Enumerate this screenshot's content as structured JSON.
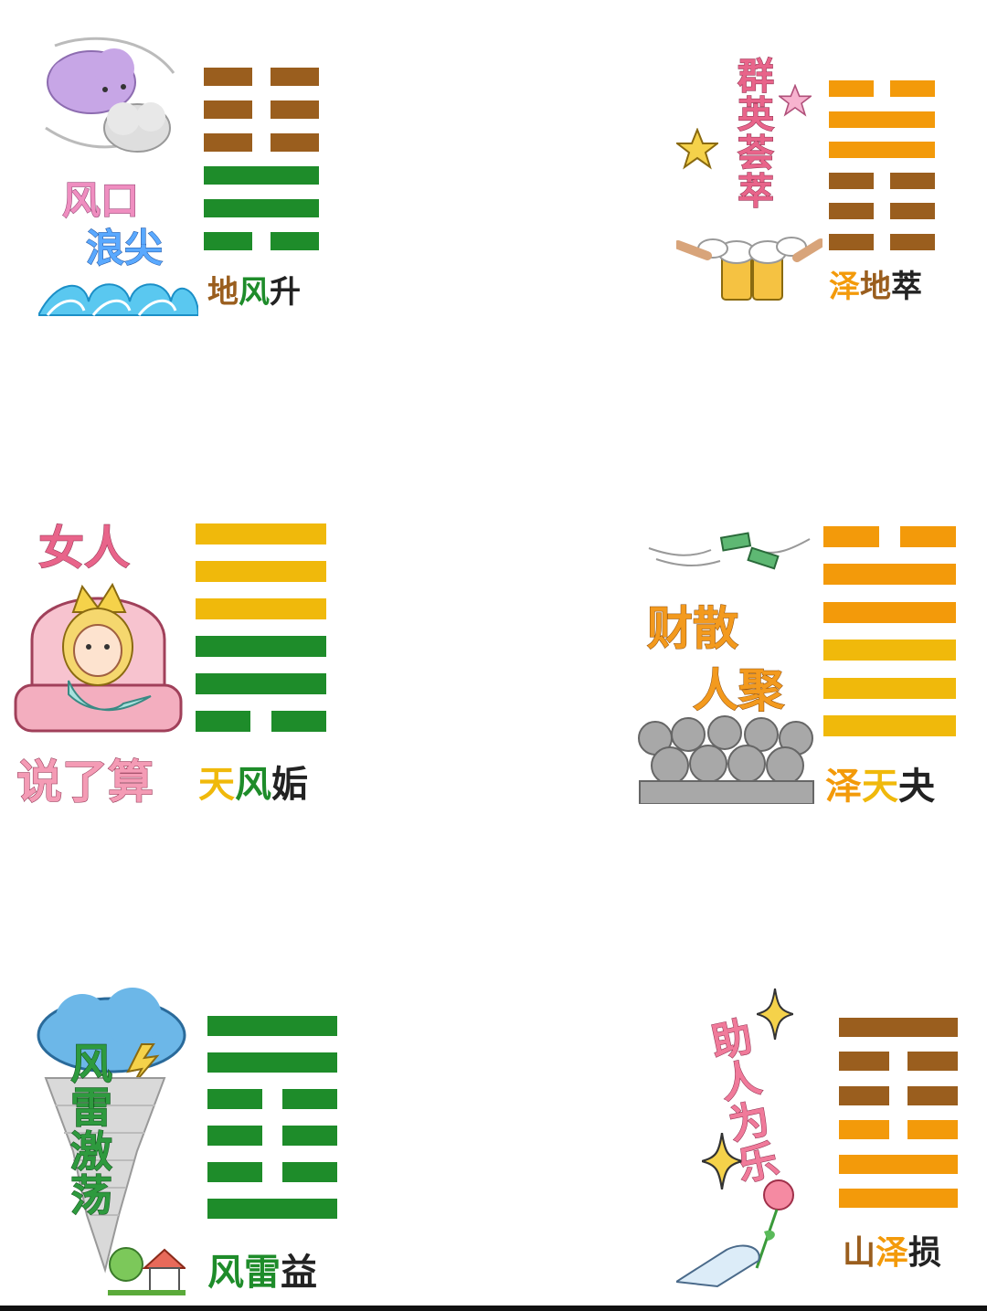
{
  "colors": {
    "brown": "#9a5e1e",
    "green": "#1e8c2a",
    "gold": "#f0b90b",
    "orange": "#f39a0a",
    "black": "#222222",
    "pink": "#e8759a"
  },
  "cards": [
    {
      "id": "sheng",
      "slogan": [
        "风口",
        "浪尖"
      ],
      "name": [
        {
          "char": "地",
          "color": "brown"
        },
        {
          "char": "风",
          "color": "green"
        },
        {
          "char": "升",
          "color": "black"
        }
      ],
      "lines_top_to_bottom": [
        {
          "type": "yin",
          "color": "brown"
        },
        {
          "type": "yin",
          "color": "brown"
        },
        {
          "type": "yin",
          "color": "brown"
        },
        {
          "type": "yang",
          "color": "green"
        },
        {
          "type": "yang",
          "color": "green"
        },
        {
          "type": "yin",
          "color": "green"
        }
      ],
      "art_icons": [
        "wind-cloud-icon",
        "wave-icon"
      ]
    },
    {
      "id": "cui",
      "slogan": [
        "群英荟萃"
      ],
      "name": [
        {
          "char": "泽",
          "color": "orange"
        },
        {
          "char": "地",
          "color": "brown"
        },
        {
          "char": "萃",
          "color": "black"
        }
      ],
      "lines_top_to_bottom": [
        {
          "type": "yin",
          "color": "orange"
        },
        {
          "type": "yang",
          "color": "orange"
        },
        {
          "type": "yang",
          "color": "orange"
        },
        {
          "type": "yin",
          "color": "brown"
        },
        {
          "type": "yin",
          "color": "brown"
        },
        {
          "type": "yin",
          "color": "brown"
        }
      ],
      "art_icons": [
        "star-icon",
        "beer-toast-icon"
      ]
    },
    {
      "id": "gou",
      "slogan": [
        "女人",
        "说了算"
      ],
      "name": [
        {
          "char": "天",
          "color": "gold"
        },
        {
          "char": "风",
          "color": "green"
        },
        {
          "char": "姤",
          "color": "black"
        }
      ],
      "lines_top_to_bottom": [
        {
          "type": "yang",
          "color": "gold"
        },
        {
          "type": "yang",
          "color": "gold"
        },
        {
          "type": "yang",
          "color": "gold"
        },
        {
          "type": "yang",
          "color": "green"
        },
        {
          "type": "yang",
          "color": "green"
        },
        {
          "type": "yin",
          "color": "green"
        }
      ],
      "art_icons": [
        "queen-on-throne-icon"
      ]
    },
    {
      "id": "guai",
      "slogan": [
        "财散",
        "人聚"
      ],
      "name": [
        {
          "char": "泽",
          "color": "orange"
        },
        {
          "char": "天",
          "color": "gold"
        },
        {
          "char": "夬",
          "color": "black"
        }
      ],
      "lines_top_to_bottom": [
        {
          "type": "yin",
          "color": "orange"
        },
        {
          "type": "yang",
          "color": "orange"
        },
        {
          "type": "yang",
          "color": "orange"
        },
        {
          "type": "yang",
          "color": "gold"
        },
        {
          "type": "yang",
          "color": "gold"
        },
        {
          "type": "yang",
          "color": "gold"
        }
      ],
      "art_icons": [
        "flying-money-icon",
        "crowd-icon"
      ]
    },
    {
      "id": "yi",
      "slogan": [
        "风雷激荡"
      ],
      "name": [
        {
          "char": "风",
          "color": "green"
        },
        {
          "char": "雷",
          "color": "green"
        },
        {
          "char": "益",
          "color": "black"
        }
      ],
      "lines_top_to_bottom": [
        {
          "type": "yang",
          "color": "green"
        },
        {
          "type": "yang",
          "color": "green"
        },
        {
          "type": "yin",
          "color": "green"
        },
        {
          "type": "yin",
          "color": "green"
        },
        {
          "type": "yin",
          "color": "green"
        },
        {
          "type": "yang",
          "color": "green"
        }
      ],
      "art_icons": [
        "storm-cloud-icon",
        "tornado-icon",
        "house-icon"
      ]
    },
    {
      "id": "sun",
      "slogan": [
        "助人为乐"
      ],
      "name": [
        {
          "char": "山",
          "color": "brown"
        },
        {
          "char": "泽",
          "color": "orange"
        },
        {
          "char": "损",
          "color": "black"
        }
      ],
      "lines_top_to_bottom": [
        {
          "type": "yang",
          "color": "brown"
        },
        {
          "type": "yin",
          "color": "brown"
        },
        {
          "type": "yin",
          "color": "brown"
        },
        {
          "type": "yin",
          "color": "orange"
        },
        {
          "type": "yang",
          "color": "orange"
        },
        {
          "type": "yang",
          "color": "orange"
        }
      ],
      "art_icons": [
        "sparkle-icon",
        "hand-with-rose-icon"
      ]
    }
  ]
}
